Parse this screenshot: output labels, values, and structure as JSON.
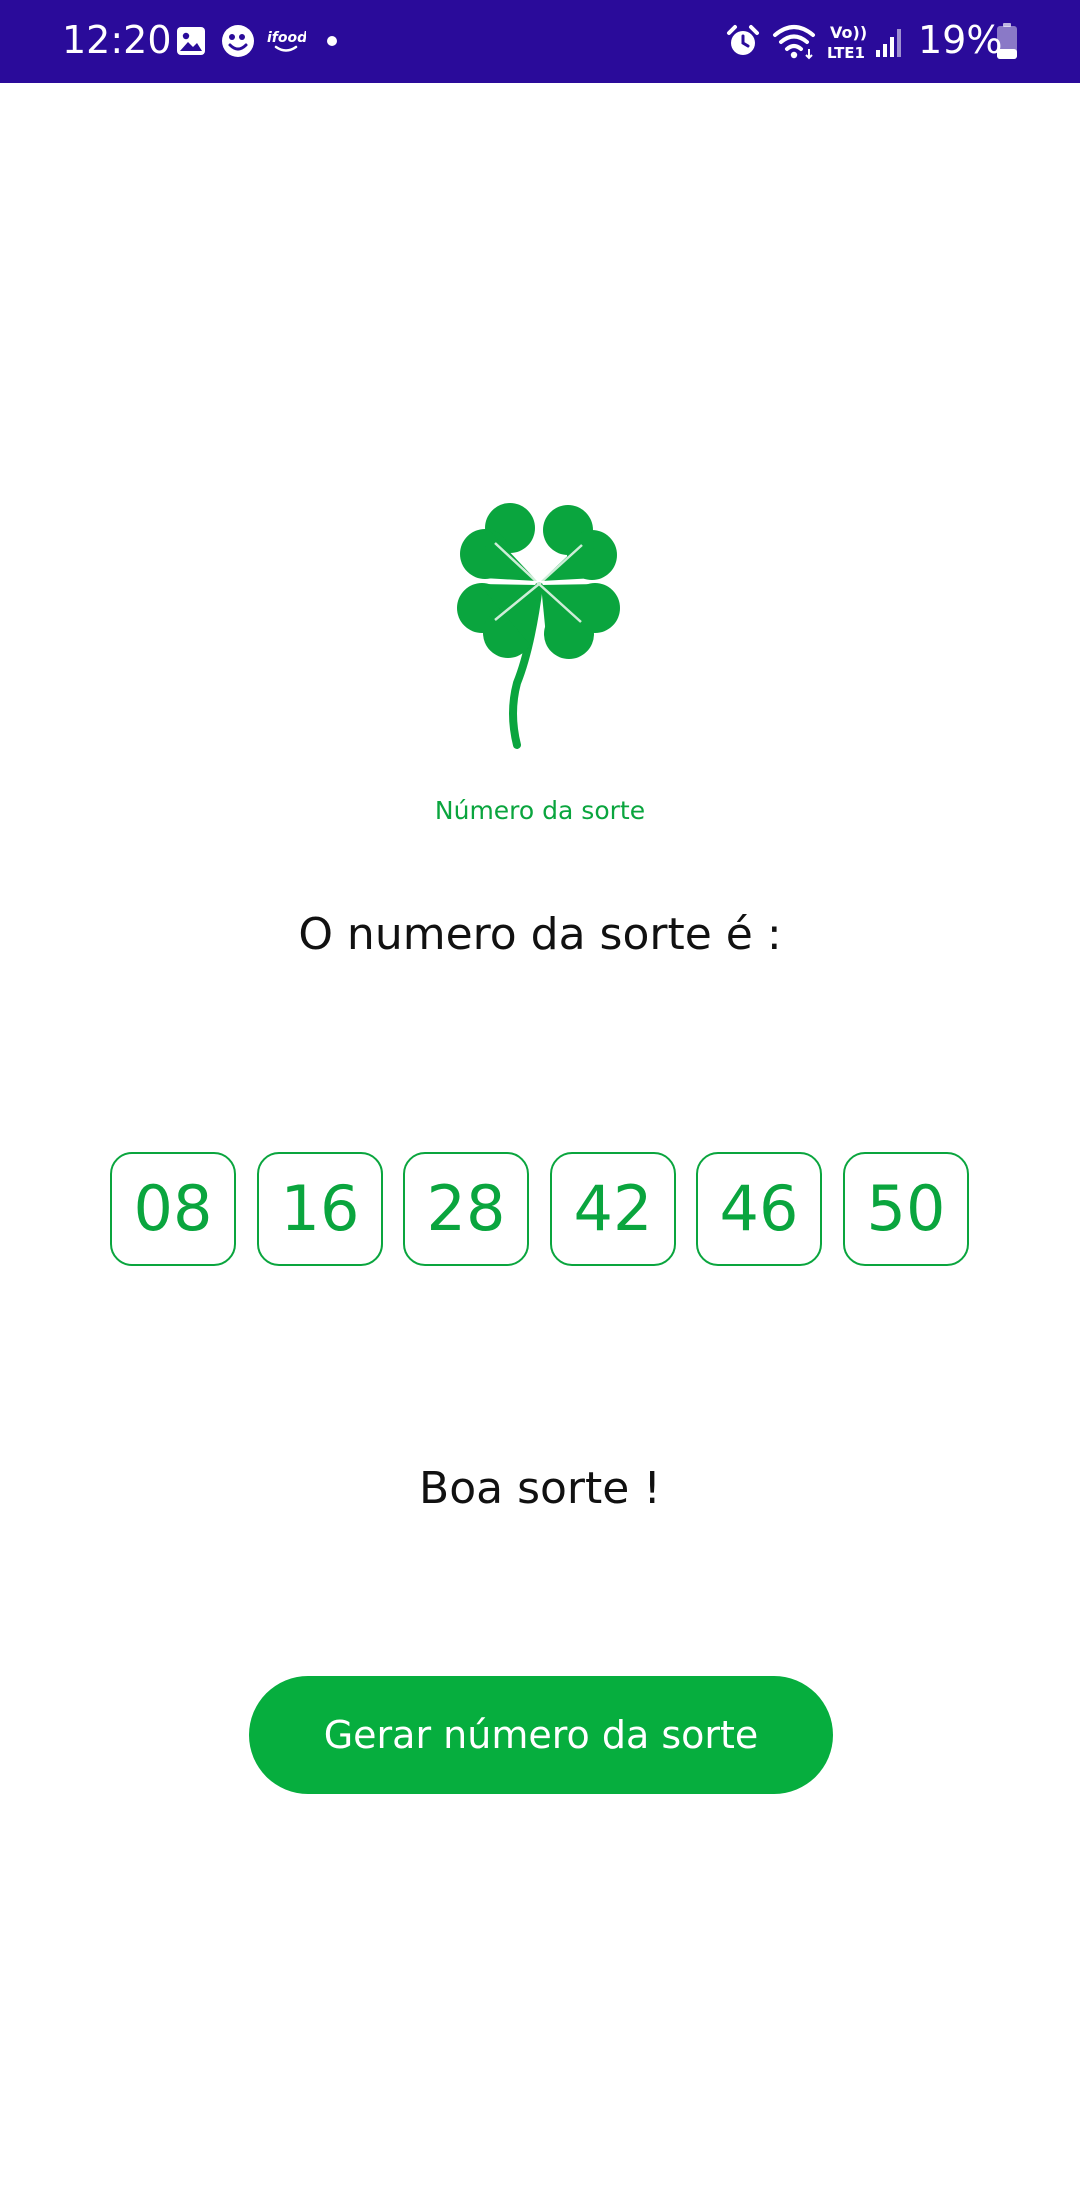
{
  "status_bar": {
    "time": "12:20",
    "left_icons": [
      "gallery-icon",
      "smiley-icon",
      "ifood-icon",
      "dot-icon"
    ],
    "ifood_label": "ifood",
    "right_icons": [
      "alarm-icon",
      "wifi-icon",
      "volte-icon",
      "signal-icon",
      "battery-icon"
    ],
    "volte_label_top": "Vo))",
    "volte_label_bottom": "LTE1",
    "battery_percent": "19%",
    "background_color": "#2a0b9a"
  },
  "logo": {
    "icon": "four-leaf-clover-icon",
    "caption": "Número da sorte",
    "color": "#0aa53e"
  },
  "headline": "O numero da sorte é :",
  "numbers": [
    "08",
    "16",
    "28",
    "42",
    "46",
    "50"
  ],
  "message": "Boa sorte !",
  "button": {
    "label": "Gerar número da sorte",
    "color": "#06ae3e"
  }
}
